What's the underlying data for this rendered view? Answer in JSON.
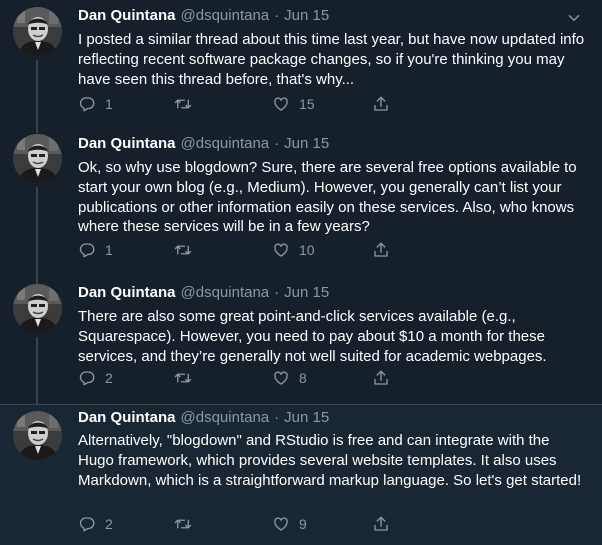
{
  "tweets": [
    {
      "name": "Dan Quintana",
      "handle": "@dsquintana",
      "separator": "·",
      "date": "Jun 15",
      "text": "I posted a similar thread about this time last year, but have now updated info reflecting recent software package changes, so if you're thinking you may have seen this thread before, that's why...",
      "replies": "1",
      "retweets": "",
      "likes": "15"
    },
    {
      "name": "Dan Quintana",
      "handle": "@dsquintana",
      "separator": "·",
      "date": "Jun 15",
      "text": "Ok, so why use blogdown? Sure, there are several free options available to start your own blog (e.g., Medium). However, you generally can’t list your publications or other information easily on these services. Also, who knows where these services will be in a few years?",
      "replies": "1",
      "retweets": "",
      "likes": "10"
    },
    {
      "name": "Dan Quintana",
      "handle": "@dsquintana",
      "separator": "·",
      "date": "Jun 15",
      "text": "There are also some great point-and-click services available (e.g., Squarespace). However, you need to pay about $10 a month for these services, and they’re generally not well suited for academic webpages.",
      "replies": "2",
      "retweets": "",
      "likes": "8"
    },
    {
      "name": "Dan Quintana",
      "handle": "@dsquintana",
      "separator": "·",
      "date": "Jun 15",
      "text": "Alternatively, \"blogdown\" and RStudio is free and can integrate with the Hugo framework, which provides several website templates. It also uses Markdown, which is a straightforward markup language. So let's get started!",
      "replies": "2",
      "retweets": "",
      "likes": "9"
    }
  ],
  "colors": {
    "background": "#15202b",
    "highlight_background": "#192734",
    "secondary_text": "#8899a6",
    "thread_line": "#38444d"
  }
}
